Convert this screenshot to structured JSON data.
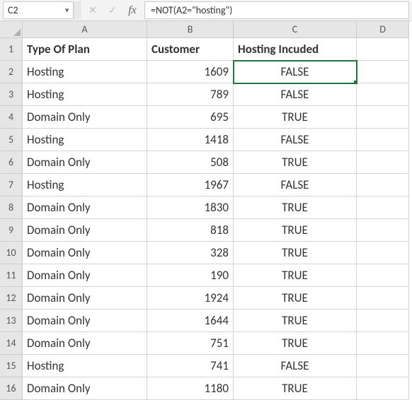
{
  "nameBox": {
    "value": "C2"
  },
  "formulaBar": {
    "formula": "=NOT(A2=\"hosting\")"
  },
  "columns": [
    "A",
    "B",
    "C",
    "D"
  ],
  "headers": {
    "A": "Type Of Plan",
    "B": "Customer",
    "C": "Hosting Incuded"
  },
  "activeCell": "C2",
  "rows": [
    {
      "n": 2,
      "A": "Hosting",
      "B": 1609,
      "C": "FALSE"
    },
    {
      "n": 3,
      "A": "Hosting",
      "B": 789,
      "C": "FALSE"
    },
    {
      "n": 4,
      "A": "Domain Only",
      "B": 695,
      "C": "TRUE"
    },
    {
      "n": 5,
      "A": "Hosting",
      "B": 1418,
      "C": "FALSE"
    },
    {
      "n": 6,
      "A": "Domain Only",
      "B": 508,
      "C": "TRUE"
    },
    {
      "n": 7,
      "A": "Hosting",
      "B": 1967,
      "C": "FALSE"
    },
    {
      "n": 8,
      "A": "Domain Only",
      "B": 1830,
      "C": "TRUE"
    },
    {
      "n": 9,
      "A": "Domain Only",
      "B": 818,
      "C": "TRUE"
    },
    {
      "n": 10,
      "A": "Domain Only",
      "B": 328,
      "C": "TRUE"
    },
    {
      "n": 11,
      "A": "Domain Only",
      "B": 190,
      "C": "TRUE"
    },
    {
      "n": 12,
      "A": "Domain Only",
      "B": 1924,
      "C": "TRUE"
    },
    {
      "n": 13,
      "A": "Domain Only",
      "B": 1644,
      "C": "TRUE"
    },
    {
      "n": 14,
      "A": "Domain Only",
      "B": 751,
      "C": "TRUE"
    },
    {
      "n": 15,
      "A": "Hosting",
      "B": 741,
      "C": "FALSE"
    },
    {
      "n": 16,
      "A": "Domain Only",
      "B": 1180,
      "C": "TRUE"
    }
  ]
}
